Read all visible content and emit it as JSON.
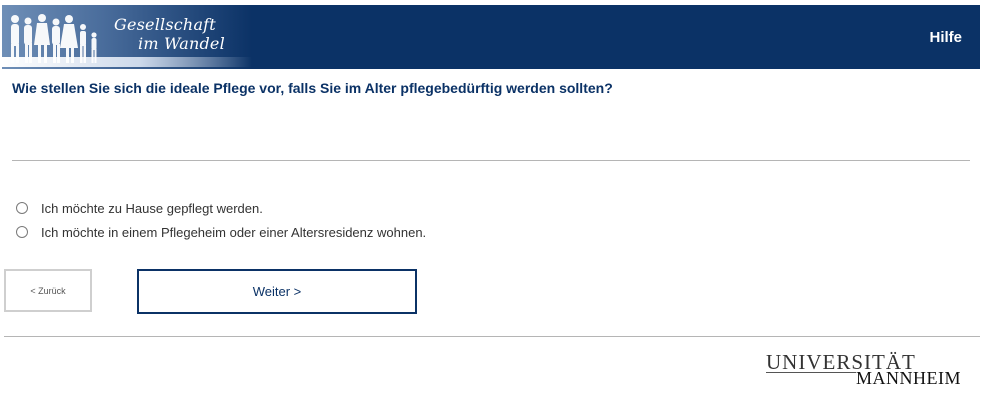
{
  "header": {
    "logo_line1": "Gesellschaft",
    "logo_line2": "im Wandel",
    "help_label": "Hilfe",
    "brand_color": "#0b3266"
  },
  "question": {
    "text": "Wie stellen Sie sich die ideale Pflege vor, falls Sie im Alter pflegebedürftig werden sollten?"
  },
  "options": [
    {
      "label": "Ich möchte zu Hause gepflegt werden.",
      "selected": false
    },
    {
      "label": "Ich möchte in einem Pflegeheim oder einer Altersresidenz wohnen.",
      "selected": false
    }
  ],
  "navigation": {
    "back_label": "< Zurück",
    "next_label": "Weiter >"
  },
  "footer": {
    "university_line1": "UNIVERSITÄT",
    "university_line2": "MANNHEIM"
  }
}
